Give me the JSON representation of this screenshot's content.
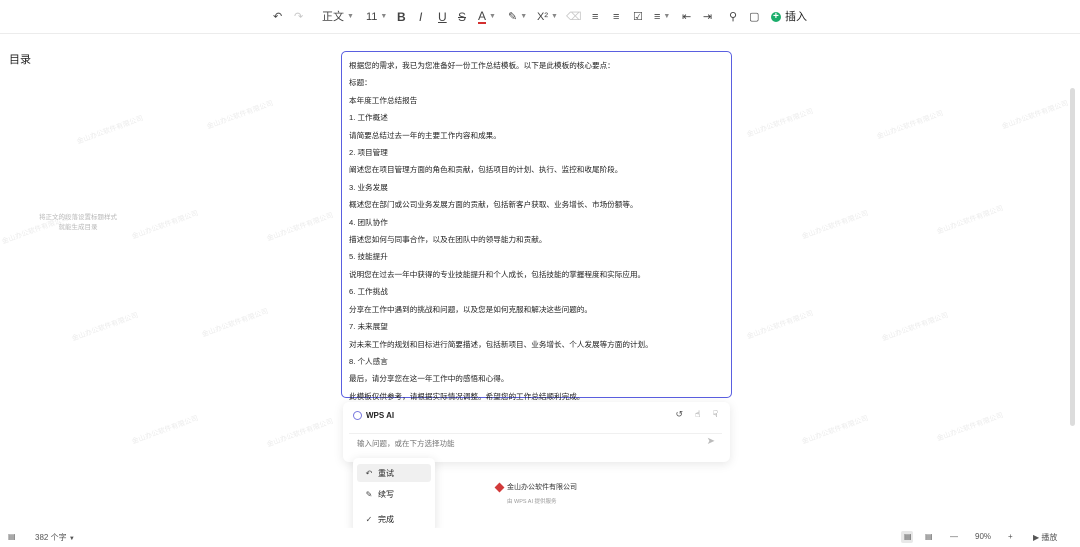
{
  "toolbar": {
    "style_label": "正文",
    "font_size": "11",
    "insert_label": "插入"
  },
  "sidebar": {
    "title": "目录",
    "hint_line1": "将正文的段落设置标题样式",
    "hint_line2": "就能生成目录"
  },
  "watermark_text": "金山办公软件有限公司",
  "document": {
    "lines": [
      "根据您的需求，我已为您准备好一份工作总结模板。以下是此模板的核心要点：",
      "标题：",
      "本年度工作总结报告",
      "1. 工作概述",
      "请简要总结过去一年的主要工作内容和成果。",
      "2. 项目管理",
      "阐述您在项目管理方面的角色和贡献，包括项目的计划、执行、监控和收尾阶段。",
      "3. 业务发展",
      "概述您在部门或公司业务发展方面的贡献，包括新客户获取、业务增长、市场份额等。",
      "4. 团队协作",
      "描述您如何与同事合作，以及在团队中的领导能力和贡献。",
      "5. 技能提升",
      "说明您在过去一年中获得的专业技能提升和个人成长，包括技能的掌握程度和实际应用。",
      "6. 工作挑战",
      "分享在工作中遇到的挑战和问题，以及您是如何克服和解决这些问题的。",
      "7. 未来展望",
      "对未来工作的规划和目标进行简要描述，包括新项目、业务增长、个人发展等方面的计划。",
      "8. 个人感言",
      "最后，请分享您在这一年工作中的感悟和心得。",
      "此模板仅供参考，请根据实际情况调整。希望您的工作总结顺利完成。"
    ]
  },
  "ai_panel": {
    "title": "WPS AI",
    "input_placeholder": "输入问题，或在下方选择功能"
  },
  "menu": {
    "items": [
      "重试",
      "续写",
      "完成"
    ]
  },
  "footer": {
    "company": "金山办公软件有限公司",
    "note": "由 WPS AI 提供服务"
  },
  "status": {
    "word_count": "382 个字",
    "zoom": "90%",
    "play_label": "播放"
  },
  "colors": {
    "selection_border": "#5a5fe0",
    "insert_accent": "#1aad6b",
    "company_logo": "#d23a3a"
  }
}
